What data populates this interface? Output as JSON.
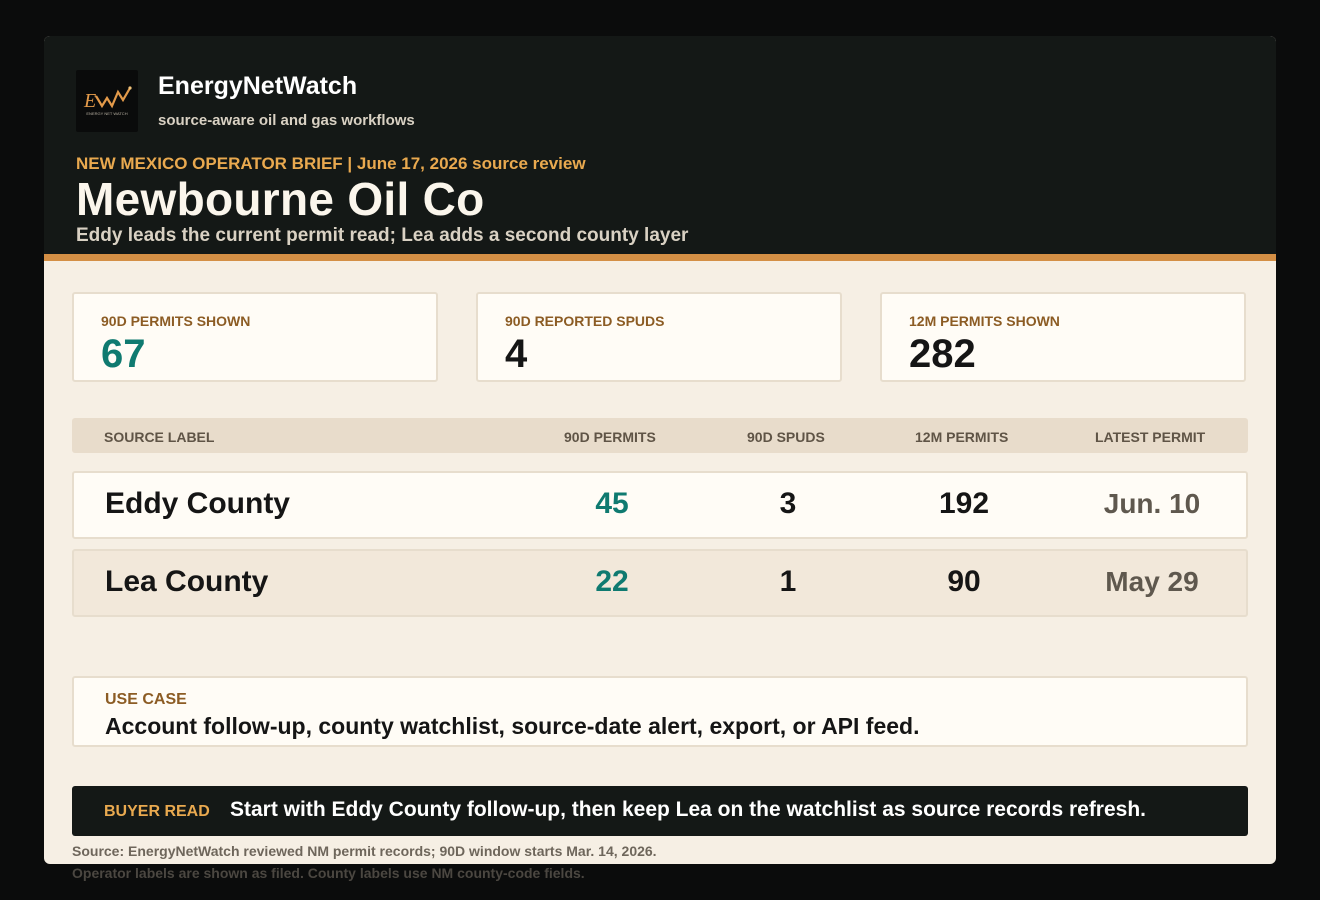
{
  "brand": {
    "name": "EnergyNetWatch",
    "tagline": "source-aware oil and gas workflows",
    "logo_mark": "EW",
    "logo_text": "ENERGY NET WATCH"
  },
  "brief": {
    "eyebrow": "NEW MEXICO OPERATOR BRIEF | June 17, 2026 source review",
    "title": "Mewbourne Oil Co",
    "subtitle": "Eddy leads the current permit read; Lea adds a second county layer"
  },
  "stats": [
    {
      "label": "90D PERMITS SHOWN",
      "value": "67"
    },
    {
      "label": "90D REPORTED SPUDS",
      "value": "4"
    },
    {
      "label": "12M PERMITS SHOWN",
      "value": "282"
    }
  ],
  "table": {
    "columns": [
      "SOURCE LABEL",
      "90D PERMITS",
      "90D SPUDS",
      "12M PERMITS",
      "LATEST PERMIT"
    ],
    "rows": [
      {
        "label": "Eddy County",
        "permits_90d": "45",
        "spuds_90d": "3",
        "permits_12m": "192",
        "latest": "Jun. 10"
      },
      {
        "label": "Lea County",
        "permits_90d": "22",
        "spuds_90d": "1",
        "permits_12m": "90",
        "latest": "May 29"
      }
    ]
  },
  "use_case": {
    "label": "USE CASE",
    "text": "Account follow-up, county watchlist, source-date alert, export, or API feed."
  },
  "buyer_read": {
    "label": "BUYER READ",
    "text": "Start with Eddy County follow-up, then keep Lea on the watchlist as source records refresh."
  },
  "footer": {
    "source": "Source: EnergyNetWatch reviewed NM permit records; 90D window starts Mar. 14, 2026.",
    "note": "Operator labels are shown as filed. County labels use NM county-code fields."
  },
  "colors": {
    "accent": "#d48f45",
    "teal": "#0f7a70",
    "dark": "#141816",
    "paper": "#f6efe4"
  }
}
